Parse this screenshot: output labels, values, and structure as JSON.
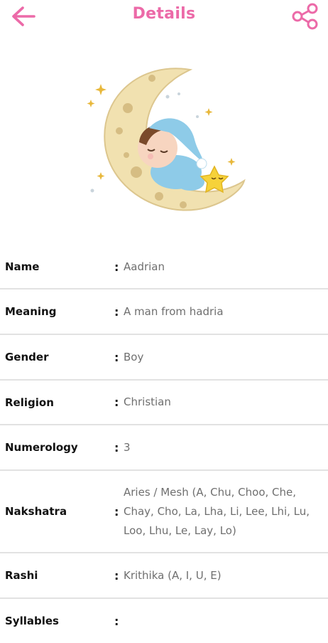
{
  "app_bar": {
    "title": "Details",
    "back_icon": "arrow-left-icon",
    "share_icon": "share-icon",
    "accent_color": "#ec6aa8"
  },
  "hero_image": "sleeping-baby-on-moon-illustration",
  "details": [
    {
      "label": "Name",
      "value": "Aadrian"
    },
    {
      "label": "Meaning",
      "value": "A man from hadria"
    },
    {
      "label": "Gender",
      "value": "Boy"
    },
    {
      "label": "Religion",
      "value": "Christian"
    },
    {
      "label": "Numerology",
      "value": "3"
    },
    {
      "label": "Nakshatra",
      "value": "Aries / Mesh (A, Chu, Choo, Che, Chay, Cho, La, Lha, Li, Lee, Lhi, Lu, Loo, Lhu, Le, Lay, Lo)"
    },
    {
      "label": "Rashi",
      "value": "Krithika (A, I, U, E)"
    },
    {
      "label": "Syllables",
      "value": ""
    }
  ],
  "separator": ":"
}
